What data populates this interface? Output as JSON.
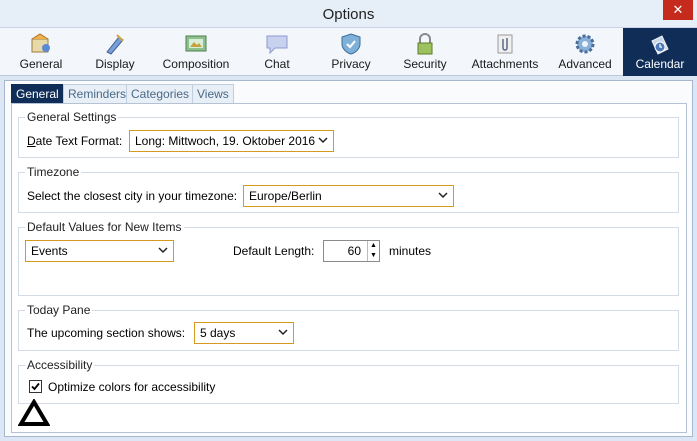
{
  "window": {
    "title": "Options",
    "close_glyph": "✕"
  },
  "categories": [
    {
      "label": "General",
      "icon": "general-icon"
    },
    {
      "label": "Display",
      "icon": "display-icon"
    },
    {
      "label": "Composition",
      "icon": "composition-icon"
    },
    {
      "label": "Chat",
      "icon": "chat-icon"
    },
    {
      "label": "Privacy",
      "icon": "privacy-icon"
    },
    {
      "label": "Security",
      "icon": "security-icon"
    },
    {
      "label": "Attachments",
      "icon": "attachments-icon"
    },
    {
      "label": "Advanced",
      "icon": "advanced-icon"
    },
    {
      "label": "Calendar",
      "icon": "calendar-icon",
      "selected": true
    }
  ],
  "subtabs": [
    {
      "label": "General",
      "active": true
    },
    {
      "label": "Reminders"
    },
    {
      "label": "Categories"
    },
    {
      "label": "Views"
    }
  ],
  "general_settings": {
    "title": "General Settings",
    "date_format_label": "Date Text Format:",
    "date_format_value": "Long: Mittwoch, 19. Oktober 2016"
  },
  "timezone": {
    "title": "Timezone",
    "label": "Select the closest city in your timezone:",
    "value": "Europe/Berlin"
  },
  "defaults": {
    "title": "Default Values for New Items",
    "type_value": "Events",
    "length_label": "Default Length:",
    "length_value": "60",
    "length_unit": "minutes"
  },
  "today_pane": {
    "title": "Today Pane",
    "label": "The upcoming section shows:",
    "value": "5 days"
  },
  "accessibility": {
    "title": "Accessibility",
    "checkbox_label": "Optimize colors for accessibility",
    "checked": true
  },
  "colors": {
    "accent_selected": "#0f2d56",
    "select_border": "#d69a1e",
    "close_button": "#c42b1c"
  }
}
